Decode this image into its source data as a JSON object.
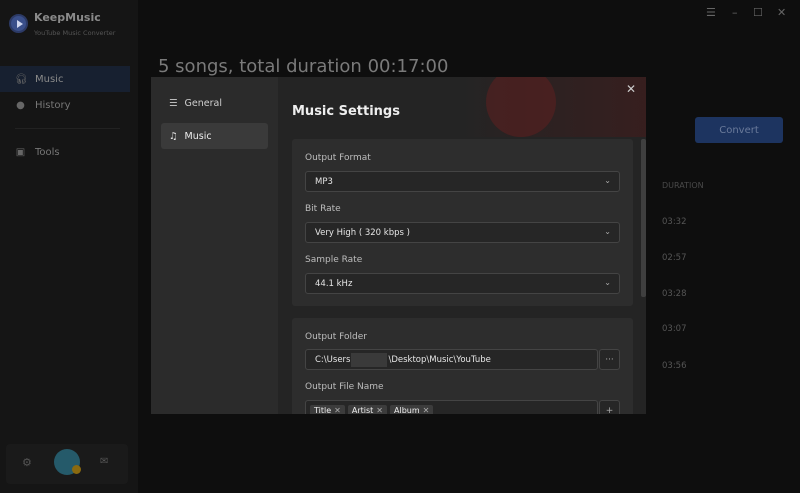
{
  "app": {
    "name": "KeepMusic",
    "subtitle": "YouTube Music Converter"
  },
  "sidebar": {
    "items": [
      {
        "label": "Music",
        "icon": "headphones-icon"
      },
      {
        "label": "History",
        "icon": "clock-icon"
      },
      {
        "label": "Tools",
        "icon": "toolbox-icon"
      }
    ]
  },
  "main": {
    "title": "5 songs, total duration 00:17:00",
    "convert_label": "Convert",
    "duration_header": "DURATION",
    "durations": [
      "03:32",
      "02:57",
      "03:28",
      "03:07",
      "03:56"
    ]
  },
  "modal": {
    "nav": [
      {
        "label": "General"
      },
      {
        "label": "Music"
      }
    ],
    "title": "Music Settings",
    "output_format": {
      "label": "Output Format",
      "value": "MP3"
    },
    "bit_rate": {
      "label": "Bit Rate",
      "value": "Very High ( 320 kbps )"
    },
    "sample_rate": {
      "label": "Sample Rate",
      "value": "44.1 kHz"
    },
    "output_folder": {
      "label": "Output Folder",
      "prefix": "C:\\Users",
      "suffix": "\\Desktop\\Music\\YouTube",
      "browse": "···"
    },
    "file_name": {
      "label": "Output File Name",
      "tags": [
        "Title",
        "Artist",
        "Album"
      ],
      "add": "+"
    }
  }
}
